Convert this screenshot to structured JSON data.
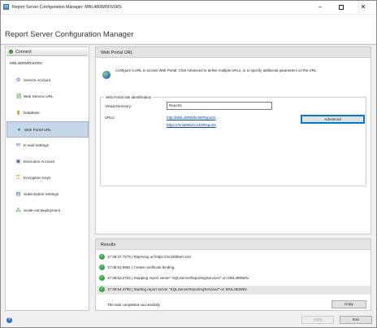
{
  "window": {
    "title": "Report Server Configuration Manager: MNL480WIN\\SSRS"
  },
  "header": {
    "title": "Report Server Configuration Manager"
  },
  "sidebar": {
    "connect_label": "Connect",
    "server": "MNL480WIN\\SSRS",
    "items": [
      {
        "label": "Service Account",
        "icon": "service-account-icon"
      },
      {
        "label": "Web Service URL",
        "icon": "web-service-url-icon"
      },
      {
        "label": "Database",
        "icon": "database-icon"
      },
      {
        "label": "Web Portal URL",
        "icon": "web-portal-url-icon",
        "selected": true
      },
      {
        "label": "E-mail Settings",
        "icon": "email-icon"
      },
      {
        "label": "Execution Account",
        "icon": "execution-account-icon"
      },
      {
        "label": "Encryption Keys",
        "icon": "encryption-keys-icon"
      },
      {
        "label": "Subscription Settings",
        "icon": "subscription-settings-icon"
      },
      {
        "label": "Scale-out Deployment",
        "icon": "scale-out-icon"
      }
    ]
  },
  "main": {
    "section_title": "Web Portal URL",
    "description": "Configure a URL to access Web Portal. Click Advanced to define multiple URLs, or to specify additional parameters on the URL.",
    "group_label": "Web Portal Site Identification",
    "virtual_directory_label": "Virtual Directory:",
    "virtual_directory_value": "Reports",
    "urls_label": "URLs:",
    "urls": [
      "http://MNL480WIN:80/Reports",
      "https://mnl480win:443/Reports"
    ],
    "advanced_label": "Advanced"
  },
  "results": {
    "title": "Results",
    "rows": [
      "17:39:47.7279 | Rejerving url https://mnl480win:443",
      "17:39:52.9951 | Create certificate binding.",
      "17:39:53.2763 | Stopping report server \"SQLServerReportingServices\" on MNL480WIN.",
      "17:39:54.3798 | Starting report server \"SQLServerReportingServices\" on MNL480WIN."
    ],
    "status": "The task completed successfully.",
    "copy_label": "Copy"
  },
  "footer": {
    "apply_label": "Apply",
    "exit_label": "Exit"
  },
  "colors": {
    "selected_nav": "#c8d6ea",
    "link": "#0645ad",
    "success": "#3da84a",
    "accent": "#0078d7"
  }
}
